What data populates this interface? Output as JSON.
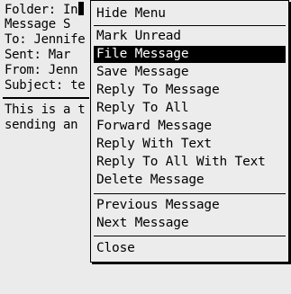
{
  "message": {
    "header_lines": [
      "Folder: In",
      "Message S",
      "To: Jennife",
      "Sent: Mar",
      "From: Jenn",
      "Subject: te"
    ],
    "body_lines": [
      "This is a t",
      "sending an"
    ]
  },
  "menu": {
    "hide_label": "Hide Menu",
    "group1": [
      {
        "label": "Mark Unread",
        "selected": false
      },
      {
        "label": "File Message",
        "selected": true
      },
      {
        "label": "Save Message",
        "selected": false
      },
      {
        "label": "Reply To Message",
        "selected": false
      },
      {
        "label": "Reply To All",
        "selected": false
      },
      {
        "label": "Forward Message",
        "selected": false
      },
      {
        "label": "Reply With Text",
        "selected": false
      },
      {
        "label": "Reply To All With Text",
        "selected": false
      },
      {
        "label": "Delete Message",
        "selected": false
      }
    ],
    "group2": [
      {
        "label": "Previous Message",
        "selected": false
      },
      {
        "label": "Next Message",
        "selected": false
      }
    ],
    "group3": [
      {
        "label": "Close",
        "selected": false
      }
    ]
  },
  "colors": {
    "background": "#ebebeb",
    "selection": "#000000",
    "selection_text": "#ffffff"
  }
}
